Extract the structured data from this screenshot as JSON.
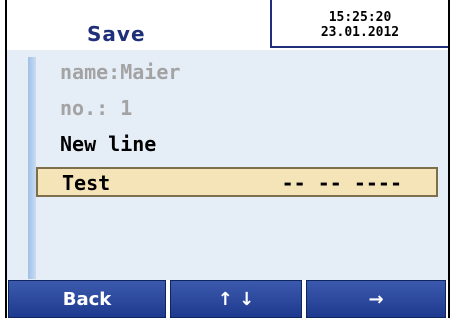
{
  "header": {
    "title": "Save",
    "time": "15:25:20",
    "date": "23.01.2012"
  },
  "list": {
    "items": [
      {
        "text": "name:Maier",
        "state": "inactive"
      },
      {
        "text": "no.: 1",
        "state": "inactive"
      },
      {
        "text": "New line",
        "state": "active"
      }
    ],
    "selected": {
      "label": "Test",
      "value": "-- -- ----"
    }
  },
  "buttons": {
    "back": "Back",
    "updown": "↑ ↓",
    "next": "→"
  },
  "colors": {
    "accent": "#1f2f7a",
    "button": "#2a479a",
    "highlight": "#f4e4b8",
    "panel": "#e5edf7",
    "inactive_text": "#a3a3a3"
  }
}
